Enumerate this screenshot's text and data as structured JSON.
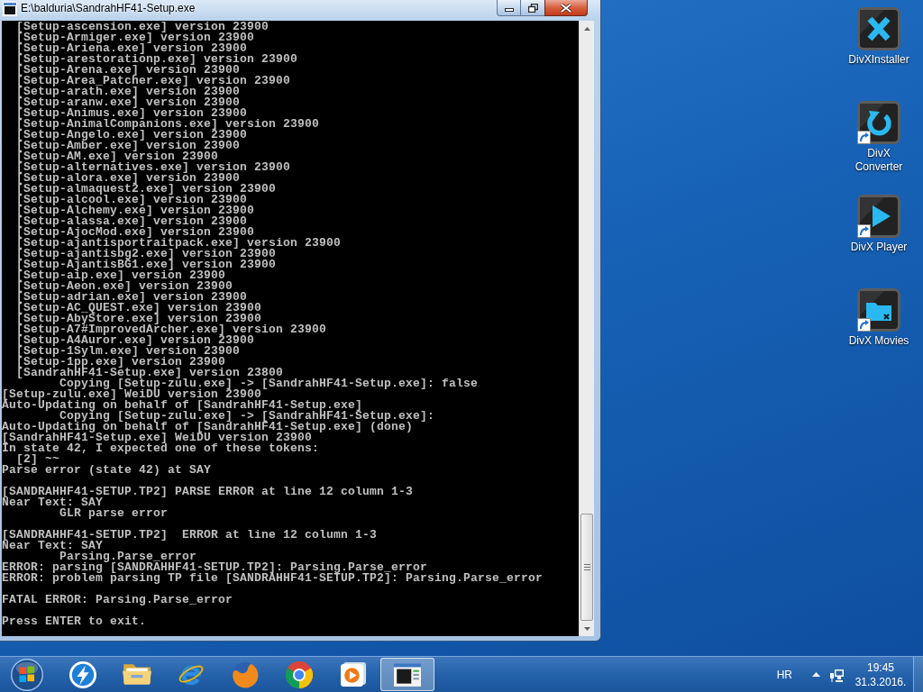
{
  "window": {
    "title": "E:\\balduria\\SandrahHF41-Setup.exe"
  },
  "console": {
    "paragraphs": [
      {
        "lines": [
          "  [Setup-ascension.exe] version 23900",
          "  [Setup-Armiger.exe] version 23900",
          "  [Setup-Ariena.exe] version 23900",
          "  [Setup-arestorationp.exe] version 23900",
          "  [Setup-Arena.exe] version 23900",
          "  [Setup-Area_Patcher.exe] version 23900",
          "  [Setup-arath.exe] version 23900",
          "  [Setup-aranw.exe] version 23900",
          "  [Setup-Animus.exe] version 23900",
          "  [Setup-AnimalCompanions.exe] version 23900",
          "  [Setup-Angelo.exe] version 23900",
          "  [Setup-Amber.exe] version 23900",
          "  [Setup-AM.exe] version 23900",
          "  [Setup-alternatives.exe] version 23900",
          "  [Setup-alora.exe] version 23900",
          "  [Setup-almaquest2.exe] version 23900",
          "  [Setup-alcool.exe] version 23900",
          "  [Setup-Alchemy.exe] version 23900",
          "  [Setup-alassa.exe] version 23900",
          "  [Setup-AjocMod.exe] version 23900",
          "  [Setup-ajantisportraitpack.exe] version 23900",
          "  [Setup-ajantisbg2.exe] version 23900",
          "  [Setup-AjantisBG1.exe] version 23900",
          "  [Setup-aip.exe] version 23900",
          "  [Setup-Aeon.exe] version 23900",
          "  [Setup-adrian.exe] version 23900",
          "  [Setup-AC_QUEST.exe] version 23900",
          "  [Setup-AbyStore.exe] version 23900",
          "  [Setup-A7#ImprovedArcher.exe] version 23900",
          "  [Setup-A4Auror.exe] version 23900",
          "  [Setup-1Sylm.exe] version 23900",
          "  [Setup-1pp.exe] version 23900",
          "  [SandrahHF41-Setup.exe] version 23800",
          "        Copying [Setup-zulu.exe] -> [SandrahHF41-Setup.exe]: false",
          "[Setup-zulu.exe] WeiDU version 23900",
          "Auto-Updating on behalf of [SandrahHF41-Setup.exe]",
          "        Copying [Setup-zulu.exe] -> [SandrahHF41-Setup.exe]:",
          "Auto-Updating on behalf of [SandrahHF41-Setup.exe] (done)",
          "[SandrahHF41-Setup.exe] WeiDU version 23900",
          "In state 42, I expected one of these tokens:",
          "  [2] ~~",
          "Parse error (state 42) at SAY"
        ]
      },
      {
        "lines": [
          "[SANDRAHHF41-SETUP.TP2] PARSE ERROR at line 12 column 1-3",
          "Near Text: SAY",
          "        GLR parse error"
        ]
      },
      {
        "lines": [
          "[SANDRAHHF41-SETUP.TP2]  ERROR at line 12 column 1-3",
          "Near Text: SAY",
          "        Parsing.Parse_error",
          "ERROR: parsing [SANDRAHHF41-SETUP.TP2]: Parsing.Parse_error",
          "ERROR: problem parsing TP file [SANDRAHHF41-SETUP.TP2]: Parsing.Parse_error"
        ]
      },
      {
        "lines": [
          "FATAL ERROR: Parsing.Parse_error"
        ]
      },
      {
        "lines": [
          "Press ENTER to exit."
        ]
      }
    ]
  },
  "desktop_icons": [
    {
      "label": "DivXInstaller",
      "kind": "installer",
      "shortcut": false
    },
    {
      "label": "DivX Converter",
      "kind": "converter",
      "shortcut": true
    },
    {
      "label": "DivX Player",
      "kind": "player",
      "shortcut": true
    },
    {
      "label": "DivX Movies",
      "kind": "movies",
      "shortcut": true
    }
  ],
  "taskbar": {
    "items": [
      {
        "kind": "lightning",
        "selected": false
      },
      {
        "kind": "folder",
        "selected": false
      },
      {
        "kind": "orbit_e",
        "selected": false
      },
      {
        "kind": "fox_globe",
        "selected": false
      },
      {
        "kind": "segmented_circle",
        "selected": false
      },
      {
        "kind": "media",
        "selected": false
      },
      {
        "kind": "console",
        "selected": true
      }
    ]
  },
  "tray": {
    "language": "HR",
    "time": "19:45",
    "date": "31.3.2016."
  }
}
